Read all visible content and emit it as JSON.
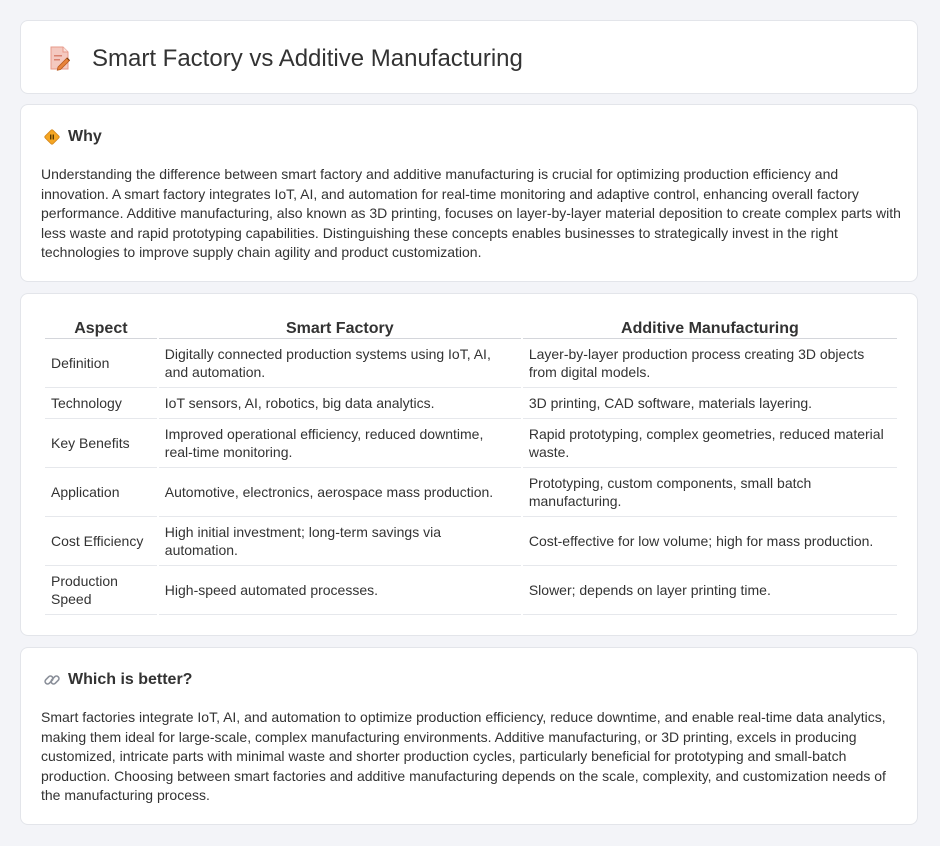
{
  "header": {
    "title": "Smart Factory vs Additive Manufacturing",
    "icon": "document-pencil-icon"
  },
  "why": {
    "icon": "diamond-sign-icon",
    "heading": "Why",
    "text": "Understanding the difference between smart factory and additive manufacturing is crucial for optimizing production efficiency and innovation. A smart factory integrates IoT, AI, and automation for real-time monitoring and adaptive control, enhancing overall factory performance. Additive manufacturing, also known as 3D printing, focuses on layer-by-layer material deposition to create complex parts with less waste and rapid prototyping capabilities. Distinguishing these concepts enables businesses to strategically invest in the right technologies to improve supply chain agility and product customization."
  },
  "comparison": {
    "headers": [
      "Aspect",
      "Smart Factory",
      "Additive Manufacturing"
    ],
    "rows": [
      [
        "Definition",
        "Digitally connected production systems using IoT, AI, and automation.",
        "Layer-by-layer production process creating 3D objects from digital models."
      ],
      [
        "Technology",
        "IoT sensors, AI, robotics, big data analytics.",
        "3D printing, CAD software, materials layering."
      ],
      [
        "Key Benefits",
        "Improved operational efficiency, reduced downtime, real-time monitoring.",
        "Rapid prototyping, complex geometries, reduced material waste."
      ],
      [
        "Application",
        "Automotive, electronics, aerospace mass production.",
        "Prototyping, custom components, small batch manufacturing."
      ],
      [
        "Cost Efficiency",
        "High initial investment; long-term savings via automation.",
        "Cost-effective for low volume; high for mass production."
      ],
      [
        "Production Speed",
        "High-speed automated processes.",
        "Slower; depends on layer printing time."
      ]
    ]
  },
  "better": {
    "icon": "link-icon",
    "heading": "Which is better?",
    "text": "Smart factories integrate IoT, AI, and automation to optimize production efficiency, reduce downtime, and enable real-time data analytics, making them ideal for large-scale, complex manufacturing environments. Additive manufacturing, or 3D printing, excels in producing customized, intricate parts with minimal waste and shorter production cycles, particularly beneficial for prototyping and small-batch production. Choosing between smart factories and additive manufacturing depends on the scale, complexity, and customization needs of the manufacturing process."
  },
  "colors": {
    "background": "#f3f4f8",
    "card": "#ffffff",
    "icon_accent": "#e8833a"
  }
}
